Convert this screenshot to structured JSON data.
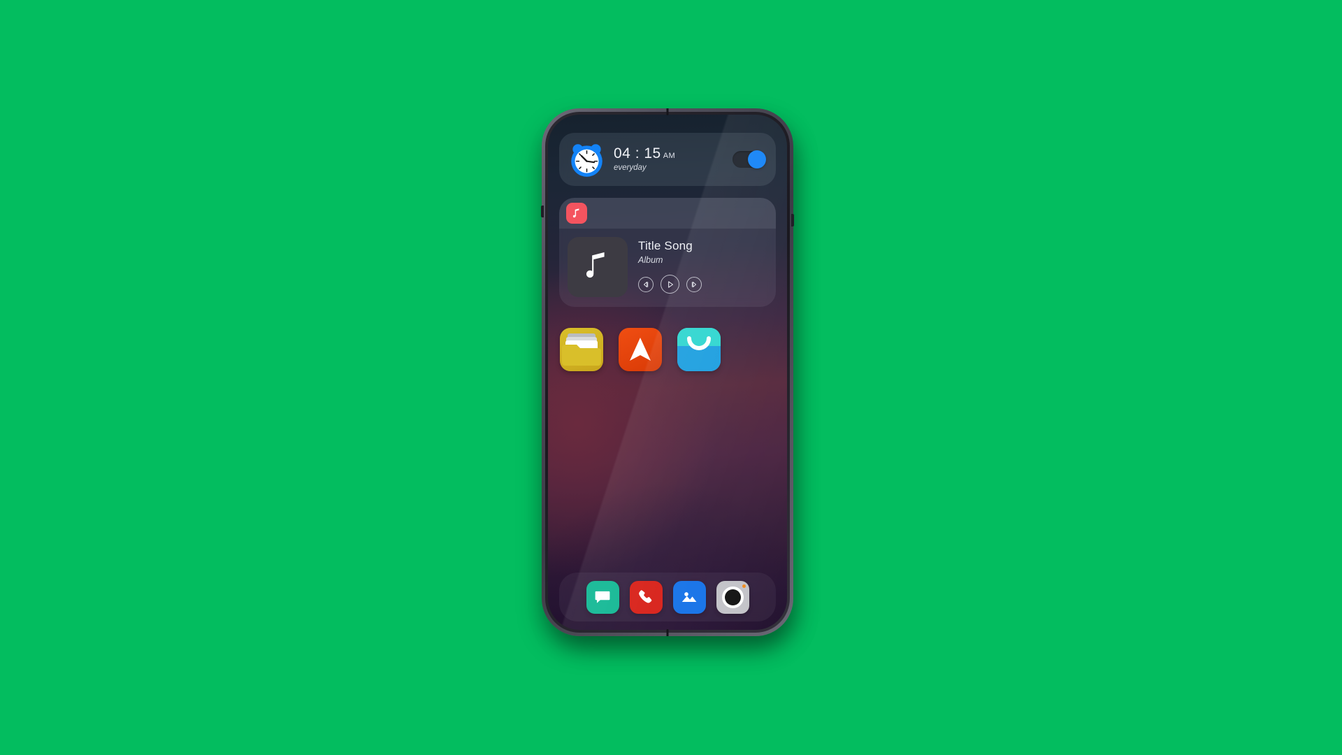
{
  "background": {
    "color": "#03bd5f"
  },
  "phone": {
    "frame_color": "#514f5c",
    "screen_wallpaper_colors": [
      "#16222e",
      "#56283c",
      "#1d1029"
    ]
  },
  "alarm_widget": {
    "icon": "alarm-clock-icon",
    "time": "04 : 15",
    "meridiem": "AM",
    "repeat": "everyday",
    "toggle_state": "on",
    "toggle_color": "#1383f7"
  },
  "music_widget": {
    "app_icon": "music-note-icon",
    "app_icon_color": "#f4545f",
    "album_art_icon": "music-note-icon",
    "title": "Title Song",
    "album": "Album",
    "controls": [
      {
        "name": "previous-button",
        "glyph": "previous"
      },
      {
        "name": "play-button",
        "glyph": "play"
      },
      {
        "name": "next-button",
        "glyph": "next"
      }
    ]
  },
  "app_grid": [
    {
      "name": "files",
      "icon": "folder-icon",
      "color": "#d9bf2a"
    },
    {
      "name": "navigation",
      "icon": "navigation-arrow-icon",
      "color": "#f04e12"
    },
    {
      "name": "store",
      "icon": "shopping-bag-icon",
      "color": "#1c9fe0"
    }
  ],
  "dock": [
    {
      "name": "messages",
      "icon": "message-bubble-icon",
      "color": "#11b894"
    },
    {
      "name": "phone",
      "icon": "phone-handset-icon",
      "color": "#d81f17"
    },
    {
      "name": "gallery",
      "icon": "photo-image-icon",
      "color": "#1472e8"
    },
    {
      "name": "camera",
      "icon": "camera-lens-icon",
      "color": "#c3c3c8",
      "badge_color": "#f08b1d"
    }
  ]
}
